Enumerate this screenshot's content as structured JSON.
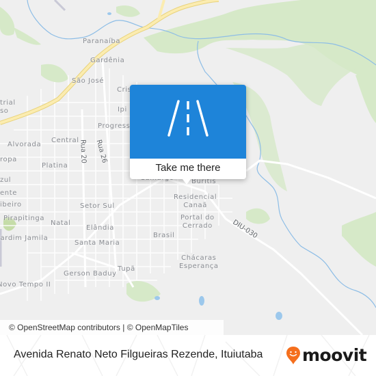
{
  "map": {
    "places": [
      {
        "name": "Paranaíba"
      },
      {
        "name": "Gardênia"
      },
      {
        "name": "São José"
      },
      {
        "name": "Cris"
      },
      {
        "name": "trial\nso"
      },
      {
        "name": "Ipi"
      },
      {
        "name": "Progress"
      },
      {
        "name": "Central"
      },
      {
        "name": "Alvorada"
      },
      {
        "name": "ropa"
      },
      {
        "name": "Platina"
      },
      {
        "name": "zul"
      },
      {
        "name": "ente"
      },
      {
        "name": "ibeiro"
      },
      {
        "name": "Setor Sul"
      },
      {
        "name": "Pirapitinga"
      },
      {
        "name": "Natal"
      },
      {
        "name": "Elândia"
      },
      {
        "name": "Jardim Jamila"
      },
      {
        "name": "Santa Maria"
      },
      {
        "name": "Brasil"
      },
      {
        "name": "Gerson Baduy"
      },
      {
        "name": "Tupã"
      },
      {
        "name": "Novo Tempo II"
      },
      {
        "name": "Camargo"
      },
      {
        "name": "Buritis"
      },
      {
        "name": "Residencial\nCanaã"
      },
      {
        "name": "Portal do\nCerrado"
      },
      {
        "name": "Chácaras\nEsperança"
      }
    ],
    "streets": [
      {
        "name": "Rua 20"
      },
      {
        "name": "Rua 26"
      },
      {
        "name": "DIU-030"
      }
    ],
    "colors": {
      "background": "#efefef",
      "park": "#d3e8c4",
      "water": "#9cc8ec",
      "highway": "#fbe9a3",
      "road": "#ffffff"
    }
  },
  "popup": {
    "icon": "road-icon",
    "cta_label": "Take me there",
    "accent": "#1e84d9"
  },
  "attribution": {
    "text": "© OpenStreetMap contributors | © OpenMapTiles"
  },
  "footer": {
    "address": "Avenida Renato Neto Filgueiras Rezende, Ituiutaba",
    "logo_text": "moovit",
    "logo_color": "#f56f1d"
  }
}
